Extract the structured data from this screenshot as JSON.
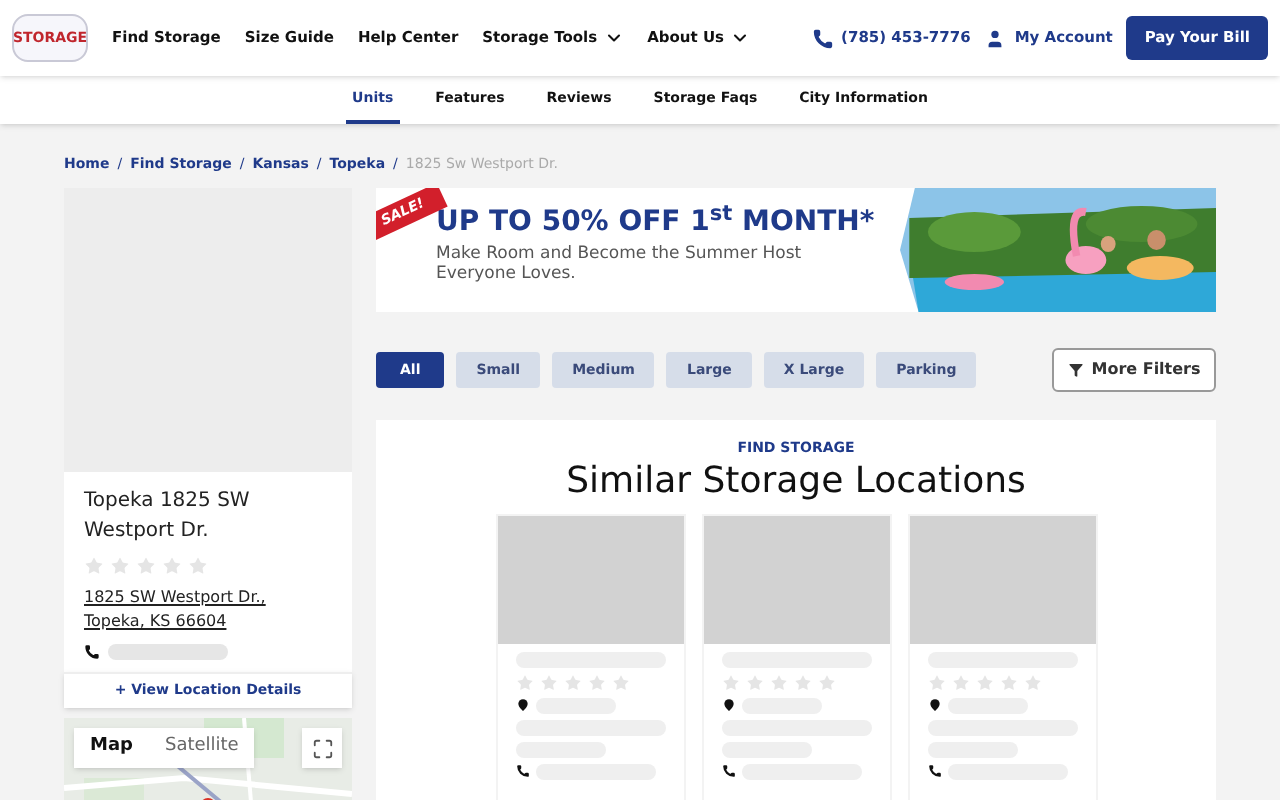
{
  "header": {
    "logo": "STORAGE",
    "nav": [
      {
        "label": "Find Storage",
        "dropdown": false
      },
      {
        "label": "Size Guide",
        "dropdown": false
      },
      {
        "label": "Help Center",
        "dropdown": false
      },
      {
        "label": "Storage Tools",
        "dropdown": true
      },
      {
        "label": "About Us",
        "dropdown": true
      }
    ],
    "phone": "(785) 453-7776",
    "account": "My Account",
    "pay_button": "Pay Your Bill"
  },
  "subnav": [
    {
      "label": "Units",
      "selected": true
    },
    {
      "label": "Features",
      "selected": false
    },
    {
      "label": "Reviews",
      "selected": false
    },
    {
      "label": "Storage Faqs",
      "selected": false
    },
    {
      "label": "City Information",
      "selected": false
    }
  ],
  "breadcrumb_separator": "/",
  "breadcrumb": [
    {
      "label": "Home",
      "current": false
    },
    {
      "label": "Find Storage",
      "current": false
    },
    {
      "label": "Kansas",
      "current": false
    },
    {
      "label": "Topeka",
      "current": false
    },
    {
      "label": "1825 Sw Westport Dr.",
      "current": true
    }
  ],
  "location": {
    "name": "Topeka 1825 SW Westport Dr.",
    "stars": 0,
    "address_line_1": "1825 SW Westport Dr.,",
    "address_line_2": "Topeka, KS 66604",
    "details_link": "+ View Location Details"
  },
  "map": {
    "tabs": [
      {
        "label": "Map",
        "selected": true
      },
      {
        "label": "Satellite",
        "selected": false
      }
    ]
  },
  "banner": {
    "badge": "SALE!",
    "headline": "UP TO 50% OFF 1$^{st}$ MONTH*",
    "subtext": "Make Room and Become the Summer Host Everyone Loves."
  },
  "filters": [
    {
      "label": "All",
      "selected": true
    },
    {
      "label": "Small",
      "selected": false
    },
    {
      "label": "Medium",
      "selected": false
    },
    {
      "label": "Large",
      "selected": false
    },
    {
      "label": "X Large",
      "selected": false
    },
    {
      "label": "Parking",
      "selected": false
    }
  ],
  "more_filters": "More Filters",
  "similar": {
    "eyebrow": "FIND STORAGE",
    "title": "Similar Storage Locations",
    "cards": [
      {
        "stars": 0
      },
      {
        "stars": 0
      },
      {
        "stars": 0
      }
    ]
  }
}
